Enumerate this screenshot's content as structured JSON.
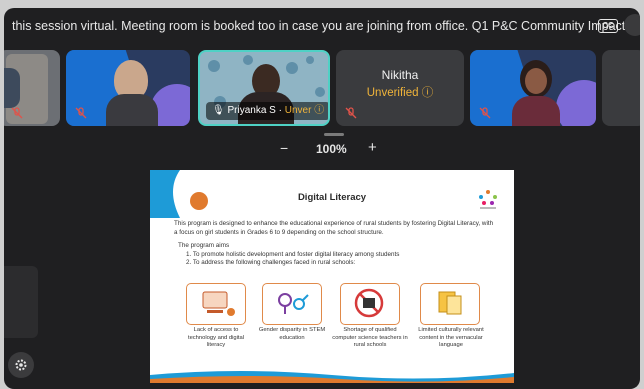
{
  "ticker": {
    "text": "this session virtual. Meeting room is booked too in case you are joining from office. Q1 P&C Community Impact -",
    "cc_label": "CC"
  },
  "participants": [
    {
      "name": "",
      "status": "muted"
    },
    {
      "name": "",
      "status": "muted"
    },
    {
      "name": "Priyanka S",
      "badge": "Unver",
      "status": "speaking"
    },
    {
      "name": "Nikitha",
      "badge": "Unverified",
      "status": "muted"
    },
    {
      "name": "",
      "status": "muted"
    }
  ],
  "zoom": {
    "minus": "−",
    "level": "100%",
    "plus": "+"
  },
  "slide": {
    "title": "Digital Literacy",
    "intro": "This program is designed to enhance the educational experience of rural students by fostering Digital Literacy, with a focus on girl students in Grades 6 to 9 depending on the school structure.",
    "aims_heading": "The program aims",
    "aim1": "1. To promote holistic development and foster digital literacy among students",
    "aim2": "2. To address the following challenges faced in rural schools:",
    "challenges": [
      "Lack of access to technology and digital literacy",
      "Gender disparity in STEM education",
      "Shortage of qualified computer science teachers in rural schools",
      "Limited culturally relevant content in the vernacular language"
    ]
  },
  "colors": {
    "accent": "#4fd1c5",
    "warning": "#f0b43a",
    "mic_off": "#e0534a",
    "card_border": "#e08a4a"
  }
}
